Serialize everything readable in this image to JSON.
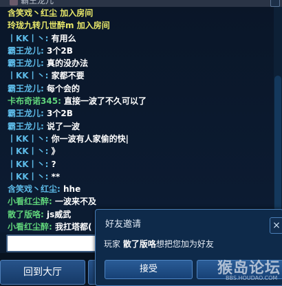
{
  "topbar": {
    "nickname": "霸王龙儿"
  },
  "colors": {
    "name_blue": "#5dbbe8",
    "name_green": "#5fd37a",
    "system_yellow": "#e8e86a",
    "message_white": "#ffffff"
  },
  "messages": [
    {
      "sender": "含笑戏丶红尘",
      "text": "加入房间",
      "name_color": "#e8e86a",
      "text_color": "#e8e86a",
      "sep": " "
    },
    {
      "sender": "玲珑九转几世醉m",
      "text": "加入房间",
      "name_color": "#e8e86a",
      "text_color": "#e8e86a",
      "sep": " "
    },
    {
      "sender": "丨KK丨丶",
      "text": "有用么",
      "name_color": "#5dbbe8",
      "text_color": "#ffffff",
      "sep": ": "
    },
    {
      "sender": "霸王龙儿",
      "text": "3个2B",
      "name_color": "#5dbbe8",
      "text_color": "#ffffff",
      "sep": ": "
    },
    {
      "sender": "霸王龙儿",
      "text": "真的没办法",
      "name_color": "#5dbbe8",
      "text_color": "#ffffff",
      "sep": ": "
    },
    {
      "sender": "丨KK丨丶",
      "text": "家都不要",
      "name_color": "#5dbbe8",
      "text_color": "#ffffff",
      "sep": ": "
    },
    {
      "sender": "霸王龙儿",
      "text": "每个会的",
      "name_color": "#5dbbe8",
      "text_color": "#ffffff",
      "sep": ": "
    },
    {
      "sender": "卡布奇诺345",
      "text": "直接一波了不久可以了",
      "name_color": "#5fd37a",
      "text_color": "#ffffff",
      "sep": ": "
    },
    {
      "sender": "霸王龙儿",
      "text": "3个2B",
      "name_color": "#5dbbe8",
      "text_color": "#ffffff",
      "sep": ": "
    },
    {
      "sender": "霸王龙儿",
      "text": "说了一波",
      "name_color": "#5dbbe8",
      "text_color": "#ffffff",
      "sep": ": "
    },
    {
      "sender": "丨KK丨丶",
      "text": "你一波有人家偷的快|",
      "name_color": "#5dbbe8",
      "text_color": "#ffffff",
      "sep": ": "
    },
    {
      "sender": "丨KK丨丶",
      "text": "》",
      "name_color": "#5dbbe8",
      "text_color": "#ffffff",
      "sep": ": "
    },
    {
      "sender": "丨KK丨丶",
      "text": "?",
      "name_color": "#5dbbe8",
      "text_color": "#ffffff",
      "sep": ": "
    },
    {
      "sender": "丨KK丨丶",
      "text": "**",
      "name_color": "#5dbbe8",
      "text_color": "#ffffff",
      "sep": ": "
    },
    {
      "sender": "含笑戏丶红尘",
      "text": "hhe",
      "name_color": "#5dbbe8",
      "text_color": "#ffffff",
      "sep": ": "
    },
    {
      "sender": "小看红尘醉",
      "text": "一波来不及",
      "name_color": "#5fd37a",
      "text_color": "#ffffff",
      "sep": ": "
    },
    {
      "sender": "散了版咯",
      "text": "js威武",
      "name_color": "#5fd37a",
      "text_color": "#ffffff",
      "sep": ": "
    },
    {
      "sender": "小看红尘醉",
      "text": "我扛塔都(",
      "name_color": "#5fd37a",
      "text_color": "#ffffff",
      "sep": ": "
    }
  ],
  "input": {
    "value": ""
  },
  "bottom": {
    "back_label": "回到大厅"
  },
  "dialog": {
    "title": "好友邀请",
    "prefix": "玩家",
    "player": "散了版咯",
    "suffix": "想把您加为好友",
    "accept_label": "接受",
    "close_label": "×"
  },
  "watermark": {
    "text": "猴岛论坛",
    "url": "BBS.HOUDAO.COM"
  }
}
